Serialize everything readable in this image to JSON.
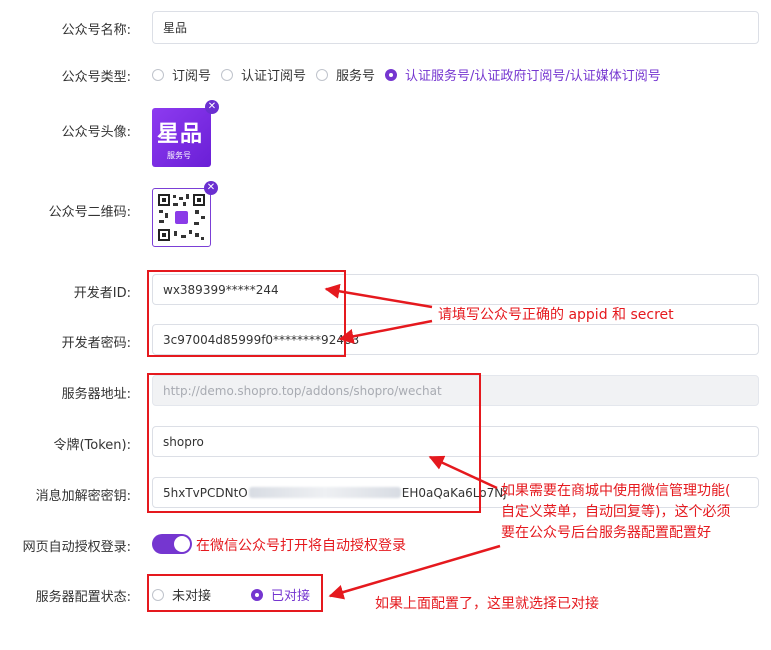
{
  "form": {
    "name": {
      "label": "公众号名称:",
      "value": "星品"
    },
    "type": {
      "label": "公众号类型:",
      "options": [
        "订阅号",
        "认证订阅号",
        "服务号",
        "认证服务号/认证政府订阅号/认证媒体订阅号"
      ],
      "selected_index": 3
    },
    "avatar": {
      "label": "公众号头像:",
      "logo_text": "星品",
      "logo_sub": "服务号"
    },
    "qrcode": {
      "label": "公众号二维码:"
    },
    "app_id": {
      "label": "开发者ID:",
      "value": "wx389399*****244"
    },
    "app_secret": {
      "label": "开发者密码:",
      "value": "3c97004d85999f0********92483"
    },
    "server_url": {
      "label": "服务器地址:",
      "value": "http://demo.shopro.top/addons/shopro/wechat"
    },
    "token": {
      "label": "令牌(Token):",
      "value": "shopro"
    },
    "aes_key": {
      "label": "消息加解密密钥:",
      "value_start": "5hxTvPCDNtO",
      "value_end": "EH0aQaKa6Lo7Nj"
    },
    "auto_login": {
      "label": "网页自动授权登录:",
      "enabled": true
    },
    "server_status": {
      "label": "服务器配置状态:",
      "options": [
        "未对接",
        "已对接"
      ],
      "selected_index": 1
    }
  },
  "annotations": {
    "appid_note": "请填写公众号正确的 appid 和 secret",
    "server_note_line1": "如果需要在商城中使用微信管理功能(",
    "server_note_line2": "自定义菜单，自动回复等)，这个必须",
    "server_note_line3": "要在公众号后台服务器配置配置好",
    "login_note": "在微信公众号打开将自动授权登录",
    "status_note": "如果上面配置了，这里就选择已对接"
  },
  "colors": {
    "accent": "#7536d0",
    "annotation_red": "#e5191e"
  }
}
